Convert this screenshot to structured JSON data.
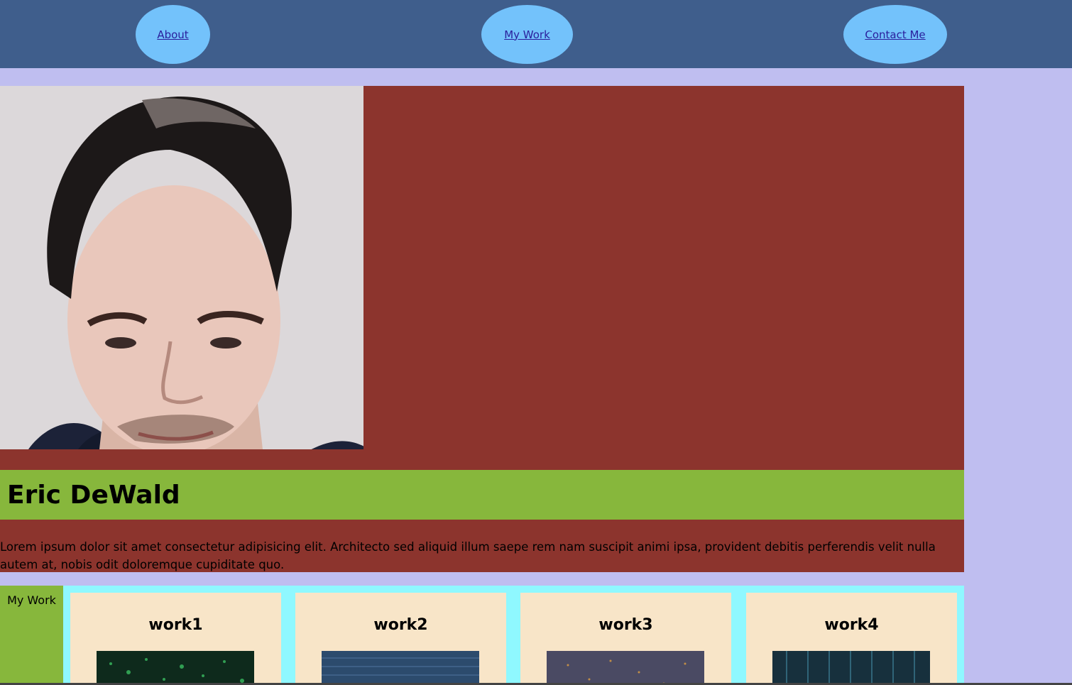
{
  "nav": {
    "about": "About",
    "my_work": "My Work",
    "contact": "Contact Me"
  },
  "profile": {
    "name": "Eric DeWald",
    "bio": "Lorem ipsum dolor sit amet consectetur adipisicing elit. Architecto sed aliquid illum saepe rem nam suscipit animi ipsa, provident debitis perferendis velit nulla autem at, nobis odit doloremque cupiditate quo."
  },
  "work": {
    "label": "My Work",
    "cards": [
      {
        "title": "work1",
        "thumb_color": "#0e2a1c"
      },
      {
        "title": "work2",
        "thumb_color": "#2c4b6d"
      },
      {
        "title": "work3",
        "thumb_color": "#4a4a63"
      },
      {
        "title": "work4",
        "thumb_color": "#17303d"
      }
    ]
  },
  "colors": {
    "page_bg": "#bfbef0",
    "navbar": "#3f5e8c",
    "nav_pill": "#73c2fb",
    "hero_bg": "#8c342d",
    "name_bar": "#87b73c",
    "work_bg": "#8ff8ff",
    "card_bg": "#f8e5c8"
  }
}
